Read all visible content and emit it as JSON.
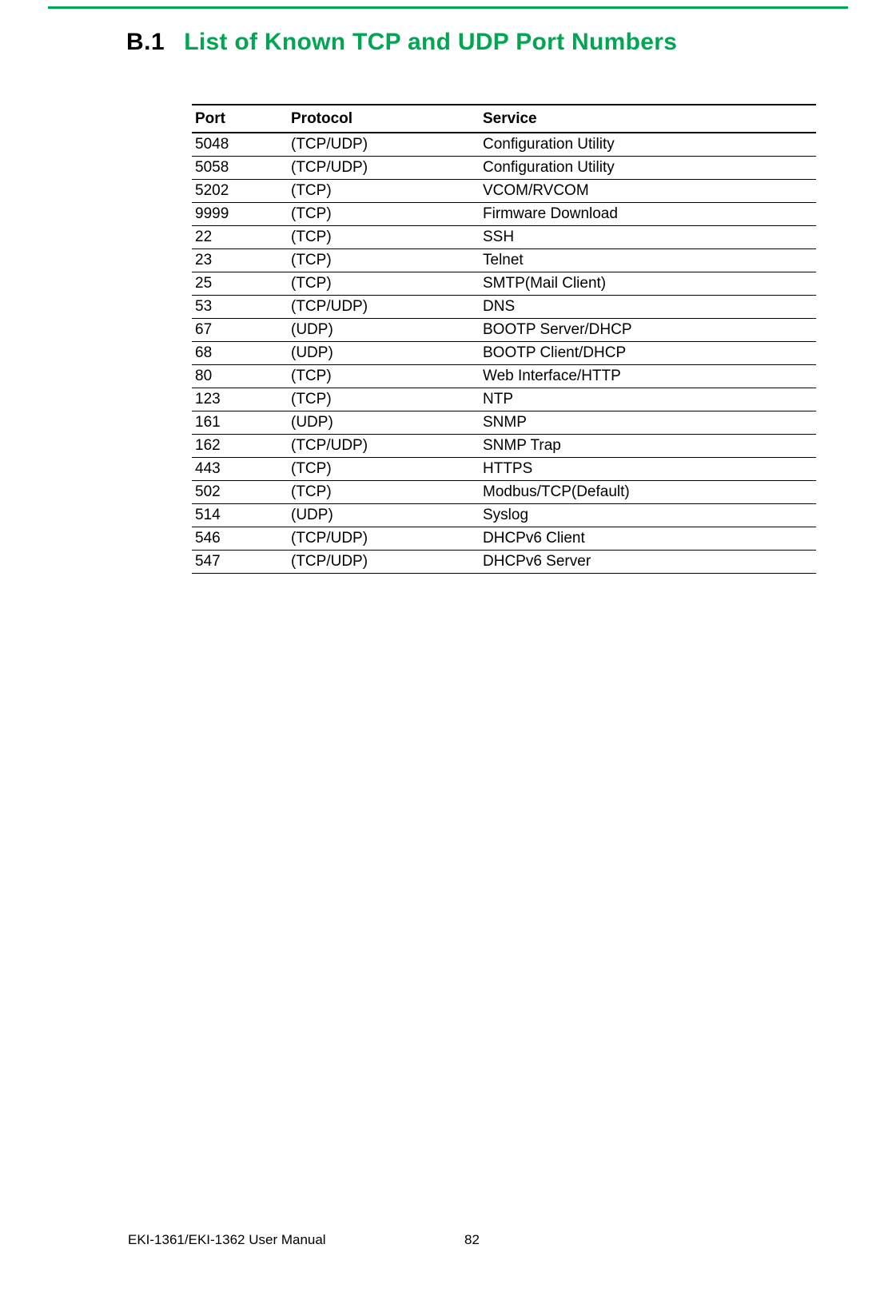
{
  "heading": {
    "number": "B.1",
    "title": "List of Known TCP and UDP Port Numbers"
  },
  "table": {
    "headers": {
      "port": "Port",
      "protocol": "Protocol",
      "service": "Service"
    },
    "rows": [
      {
        "port": "5048",
        "protocol": "(TCP/UDP)",
        "service": "Configuration Utility"
      },
      {
        "port": "5058",
        "protocol": "(TCP/UDP)",
        "service": "Configuration Utility"
      },
      {
        "port": "5202",
        "protocol": "(TCP)",
        "service": "VCOM/RVCOM"
      },
      {
        "port": "9999",
        "protocol": "(TCP)",
        "service": "Firmware Download"
      },
      {
        "port": "22",
        "protocol": "(TCP)",
        "service": "SSH"
      },
      {
        "port": "23",
        "protocol": "(TCP)",
        "service": "Telnet"
      },
      {
        "port": "25",
        "protocol": "(TCP)",
        "service": "SMTP(Mail Client)"
      },
      {
        "port": "53",
        "protocol": "(TCP/UDP)",
        "service": "DNS"
      },
      {
        "port": "67",
        "protocol": "(UDP)",
        "service": "BOOTP Server/DHCP"
      },
      {
        "port": "68",
        "protocol": "(UDP)",
        "service": "BOOTP Client/DHCP"
      },
      {
        "port": "80",
        "protocol": "(TCP)",
        "service": "Web Interface/HTTP"
      },
      {
        "port": "123",
        "protocol": "(TCP)",
        "service": "NTP"
      },
      {
        "port": "161",
        "protocol": "(UDP)",
        "service": "SNMP"
      },
      {
        "port": "162",
        "protocol": "(TCP/UDP)",
        "service": "SNMP Trap"
      },
      {
        "port": "443",
        "protocol": "(TCP)",
        "service": "HTTPS"
      },
      {
        "port": "502",
        "protocol": "(TCP)",
        "service": "Modbus/TCP(Default)"
      },
      {
        "port": "514",
        "protocol": "(UDP)",
        "service": "Syslog"
      },
      {
        "port": "546",
        "protocol": "(TCP/UDP)",
        "service": "DHCPv6 Client"
      },
      {
        "port": "547",
        "protocol": "(TCP/UDP)",
        "service": "DHCPv6 Server"
      }
    ]
  },
  "footer": {
    "manual": "EKI-1361/EKI-1362 User Manual",
    "page": "82"
  }
}
